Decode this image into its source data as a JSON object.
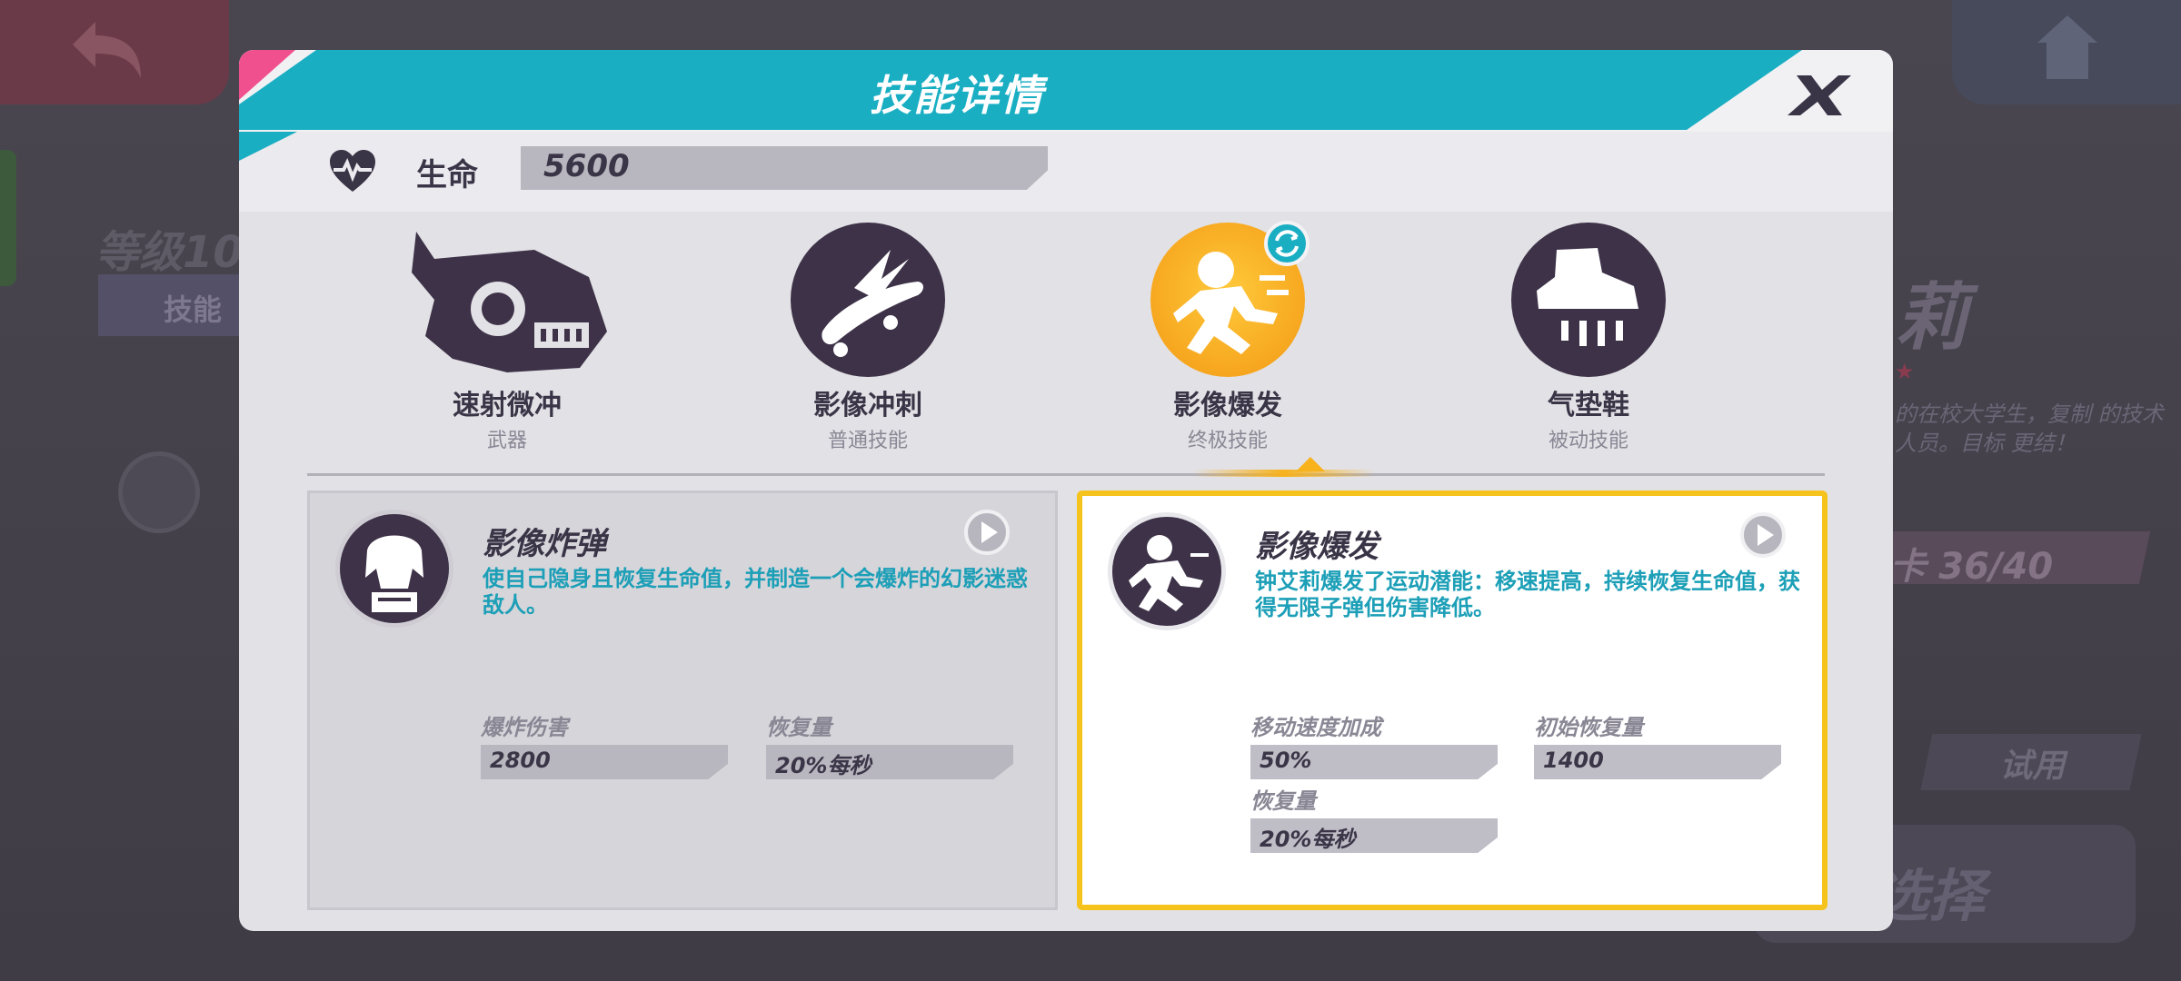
{
  "background": {
    "level_text": "等级10",
    "level_bar_text": "技能",
    "character_name": "莉",
    "stars": "★",
    "description": "的在校大学生，复制 的技术人员。目标 更结！",
    "count": "卡 36/40",
    "try_label": "试用",
    "select_label": "选择"
  },
  "modal": {
    "title": "技能详情",
    "hp": {
      "label": "生命",
      "value": "5600"
    },
    "colors": {
      "accent_teal": "#1aaec3",
      "accent_pink": "#f0508e",
      "active_yellow": "#f6c21c",
      "icon_dark": "#3d3248"
    },
    "skills": [
      {
        "name": "速射微冲",
        "type": "武器",
        "icon": "smg-weapon-icon"
      },
      {
        "name": "影像冲刺",
        "type": "普通技能",
        "icon": "skateboard-dash-icon"
      },
      {
        "name": "影像爆发",
        "type": "终极技能",
        "icon": "running-burst-icon",
        "selected": true
      },
      {
        "name": "气垫鞋",
        "type": "被动技能",
        "icon": "air-shoe-icon"
      }
    ],
    "cards": [
      {
        "title": "影像炸弹",
        "desc": "使自己隐身且恢复生命值，并制造一个会爆炸的幻影迷惑敌人。",
        "stats": [
          {
            "label": "爆炸伤害",
            "value": "2800"
          },
          {
            "label": "恢复量",
            "value": "20%每秒"
          }
        ]
      },
      {
        "title": "影像爆发",
        "desc": "钟艾莉爆发了运动潜能：移速提高，持续恢复生命值，获得无限子弹但伤害降低。",
        "stats": [
          {
            "label": "移动速度加成",
            "value": "50%"
          },
          {
            "label": "初始恢复量",
            "value": "1400"
          },
          {
            "label": "恢复量",
            "value": "20%每秒"
          }
        ]
      }
    ]
  }
}
